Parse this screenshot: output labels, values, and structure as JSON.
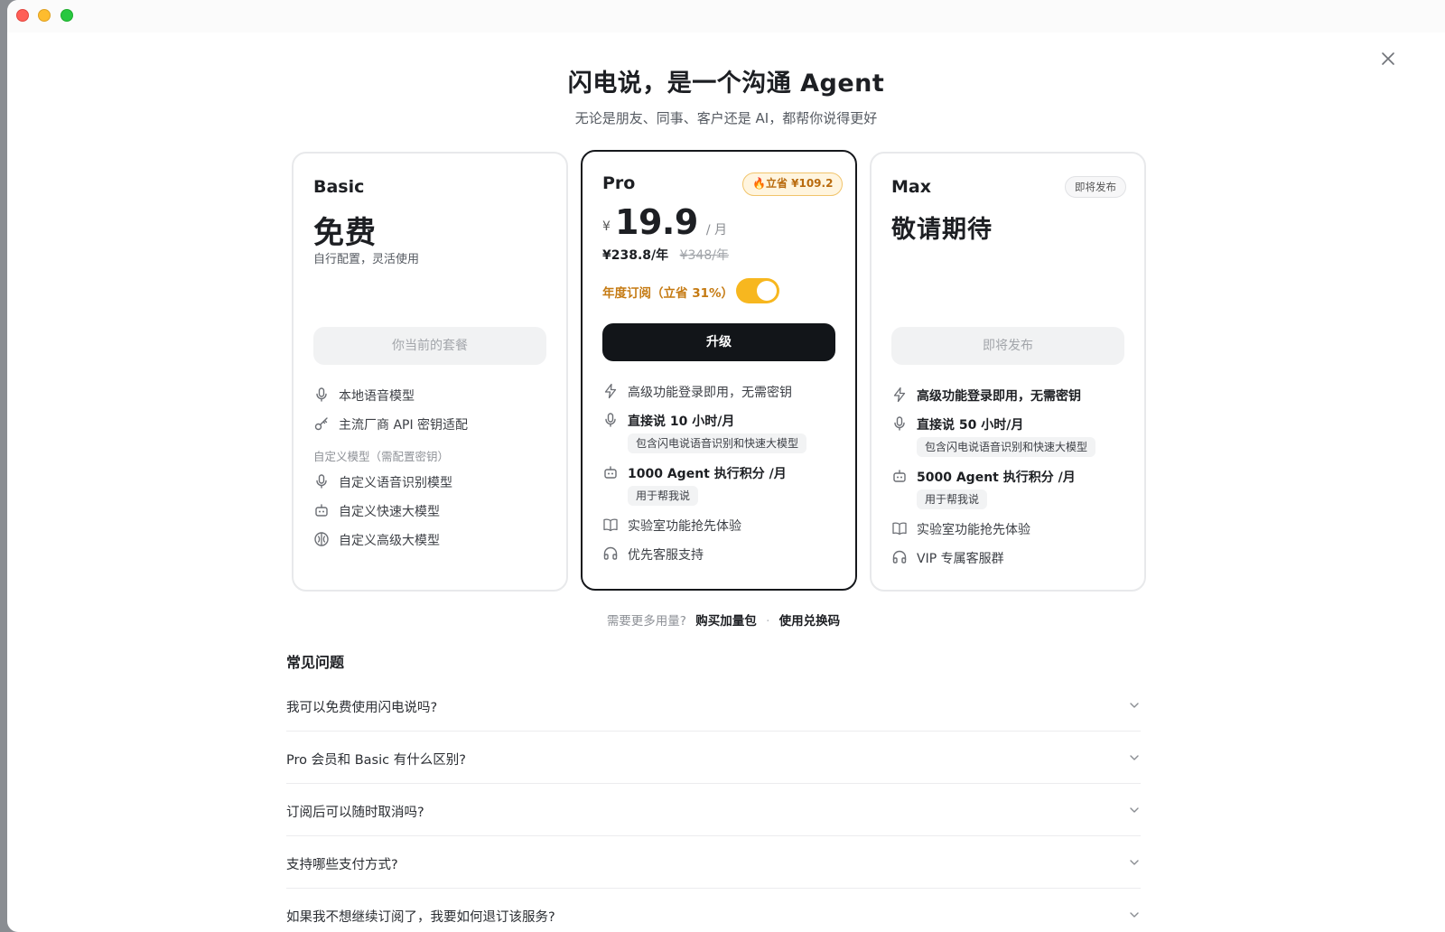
{
  "hero": {
    "title": "闪电说，是一个沟通 Agent",
    "subtitle": "无论是朋友、同事、客户还是 AI，都帮你说得更好"
  },
  "plans": {
    "basic": {
      "name": "Basic",
      "price": "免费",
      "tagline": "自行配置，灵活使用",
      "button": "你当前的套餐",
      "features": [
        {
          "icon": "mic-icon",
          "text": "本地语音模型"
        },
        {
          "icon": "key-icon",
          "text": "主流厂商 API 密钥适配"
        }
      ],
      "custom_section": "自定义模型（需配置密钥）",
      "custom_features": [
        {
          "icon": "mic-icon",
          "text": "自定义语音识别模型"
        },
        {
          "icon": "bot-icon",
          "text": "自定义快速大模型"
        },
        {
          "icon": "brain-icon",
          "text": "自定义高级大模型"
        }
      ]
    },
    "pro": {
      "name": "Pro",
      "badge": "🔥立省 ¥109.2",
      "currency": "¥",
      "price": "19.9",
      "unit": "/ 月",
      "yearly_price": "¥238.8/年",
      "yearly_original": "¥348/年",
      "annual_label": "年度订阅（立省 31%）",
      "annual_enabled": true,
      "button": "升级",
      "features": [
        {
          "icon": "bolt-icon",
          "text": "高级功能登录即用，无需密钥"
        },
        {
          "icon": "mic-icon",
          "text": "直接说 10 小时/月",
          "chip": "包含闪电说语音识别和快速大模型"
        },
        {
          "icon": "bot-icon",
          "text": "1000 Agent 执行积分 /月",
          "chip": "用于帮我说"
        },
        {
          "icon": "book-icon",
          "text": "实验室功能抢先体验"
        },
        {
          "icon": "headset-icon",
          "text": "优先客服支持"
        }
      ]
    },
    "max": {
      "name": "Max",
      "badge": "即将发布",
      "price": "敬请期待",
      "button": "即将发布",
      "features": [
        {
          "icon": "bolt-icon",
          "text": "高级功能登录即用，无需密钥"
        },
        {
          "icon": "mic-icon",
          "text": "直接说 50 小时/月",
          "chip": "包含闪电说语音识别和快速大模型"
        },
        {
          "icon": "bot-icon",
          "text": "5000 Agent 执行积分 /月",
          "chip": "用于帮我说"
        },
        {
          "icon": "book-icon",
          "text": "实验室功能抢先体验"
        },
        {
          "icon": "headset-icon",
          "text": "VIP 专属客服群"
        }
      ]
    }
  },
  "more": {
    "question": "需要更多用量?",
    "buy_pack": "购买加量包",
    "separator": "·",
    "redeem": "使用兑换码"
  },
  "faq": {
    "title": "常见问题",
    "items": [
      "我可以免费使用闪电说吗?",
      "Pro 会员和 Basic 有什么区别?",
      "订阅后可以随时取消吗?",
      "支持哪些支付方式?",
      "如果我不想继续订阅了，我要如何退订该服务?"
    ]
  },
  "colors": {
    "accent": "#f7b71f",
    "accent_text": "#c57a12",
    "primary_button": "#121519"
  }
}
